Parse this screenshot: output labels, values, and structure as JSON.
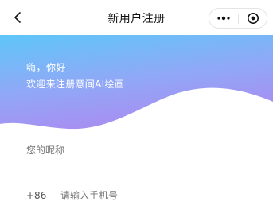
{
  "navbar": {
    "title": "新用户注册",
    "back_icon": "chevron-left-icon",
    "more_icon": "more-dots-icon",
    "close_icon": "target-close-icon"
  },
  "hero": {
    "greeting": "嗨，你好",
    "welcome": "欢迎来注册意间AI绘画",
    "gradient_colors": [
      "#5ec6f8",
      "#8fa9f7",
      "#a88ef2"
    ]
  },
  "form": {
    "nickname_placeholder": "您的昵称",
    "country_code": "+86",
    "phone_placeholder": "请输入手机号"
  }
}
